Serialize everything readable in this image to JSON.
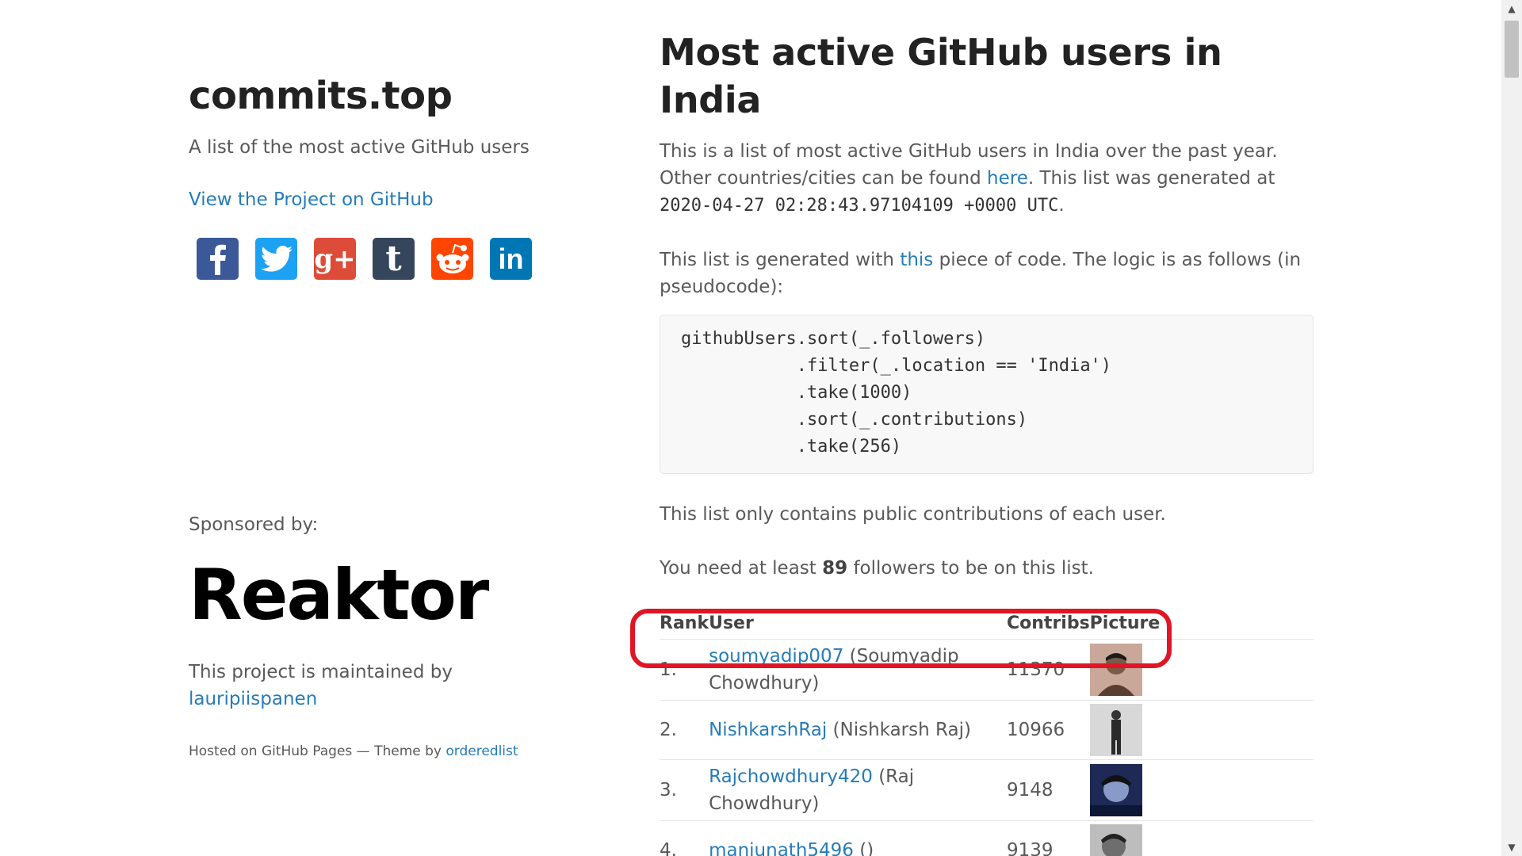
{
  "sidebar": {
    "site_title": "commits.top",
    "site_description": "A list of the most active GitHub users",
    "view_project_link": "View the Project on GitHub",
    "share_buttons": [
      {
        "name": "facebook",
        "color": "#3B5998"
      },
      {
        "name": "twitter",
        "color": "#1DA1F2"
      },
      {
        "name": "google-plus",
        "color": "#DD4B39"
      },
      {
        "name": "tumblr",
        "color": "#35465C"
      },
      {
        "name": "reddit",
        "color": "#FF4500"
      },
      {
        "name": "linkedin",
        "color": "#0077B5"
      }
    ],
    "sponsored_label": "Sponsored by:",
    "sponsor_logo_text": "Reaktor",
    "maintained_text": "This project is maintained by",
    "maintainer_link": "lauripiispanen",
    "hosted_text": "Hosted on GitHub Pages — Theme by",
    "theme_link": "orderedlist"
  },
  "main": {
    "title": "Most active GitHub users in India",
    "intro_1": "This is a list of most active GitHub users in India over the past year. Other countries/cities can be found ",
    "intro_link": "here",
    "intro_2": ". This list was generated at ",
    "generated_at": "2020-04-27 02:28:43.97104109 +0000 UTC",
    "intro_3": ".",
    "logic_1": "This list is generated with ",
    "logic_link": "this",
    "logic_2": " piece of code. The logic is as follows (in pseudocode):",
    "code_lines": [
      "githubUsers.sort(_.followers)",
      "           .filter(_.location == 'India')",
      "           .take(1000)",
      "           .sort(_.contributions)",
      "           .take(256)"
    ],
    "public_note": "This list only contains public contributions of each user.",
    "followers_1": "You need at least ",
    "followers_min": "89",
    "followers_2": " followers to be on this list.",
    "table": {
      "headers": {
        "rank": "Rank",
        "user": "User",
        "contribs": "Contribs",
        "picture": "Picture"
      },
      "rows": [
        {
          "rank": "1.",
          "username": "soumyadip007",
          "fullname": " (Soumyadip Chowdhury)",
          "contribs": "11370",
          "avatar_color": "#6a4a3a"
        },
        {
          "rank": "2.",
          "username": "NishkarshRaj",
          "fullname": " (Nishkarsh Raj)",
          "contribs": "10966",
          "avatar_color": "#9a9a9a"
        },
        {
          "rank": "3.",
          "username": "Rajchowdhury420",
          "fullname": " (Raj Chowdhury)",
          "contribs": "9148",
          "avatar_color": "#2a3a6a"
        },
        {
          "rank": "4.",
          "username": "manjunath5496",
          "fullname": " ()",
          "contribs": "9139",
          "avatar_color": "#5a5a5a"
        }
      ]
    }
  },
  "highlight_color": "#E01525"
}
